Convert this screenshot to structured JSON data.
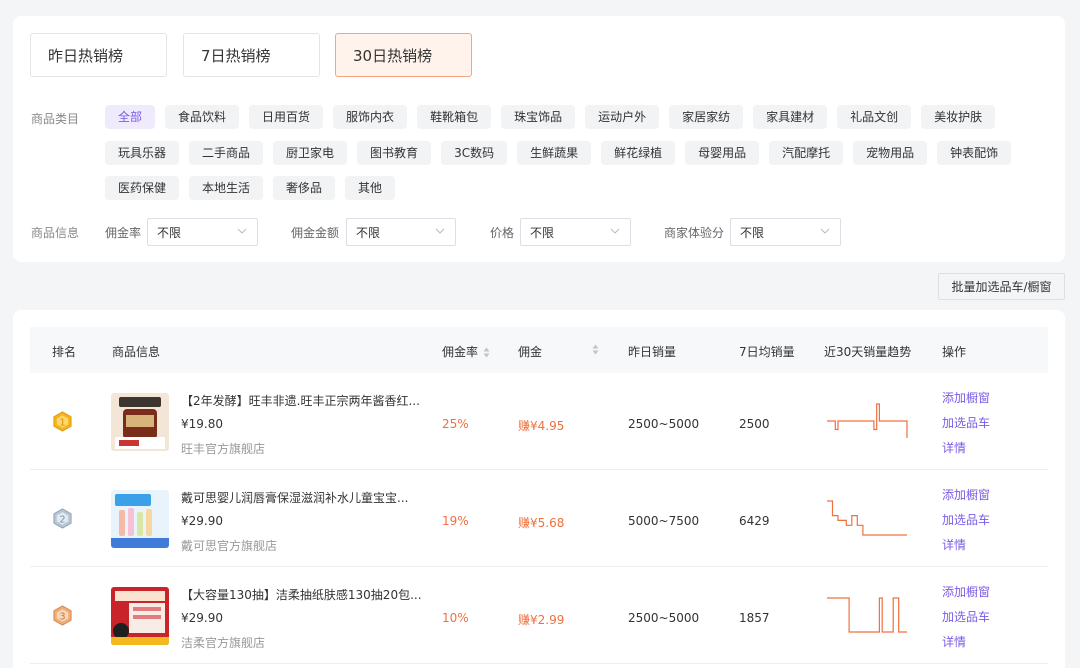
{
  "period_tabs": [
    {
      "label": "昨日热销榜"
    },
    {
      "label": "7日热销榜"
    },
    {
      "label": "30日热销榜",
      "active": true
    }
  ],
  "category": {
    "label": "商品类目",
    "rows": [
      [
        "全部",
        "食品饮料",
        "日用百货",
        "服饰内衣",
        "鞋靴箱包",
        "珠宝饰品",
        "运动户外",
        "家居家纺",
        "家具建材",
        "礼品文创",
        "美妆护肤"
      ],
      [
        "玩具乐器",
        "二手商品",
        "厨卫家电",
        "图书教育",
        "3C数码",
        "生鲜蔬果",
        "鲜花绿植",
        "母婴用品",
        "汽配摩托",
        "宠物用品",
        "钟表配饰"
      ],
      [
        "医药保健",
        "本地生活",
        "奢侈品",
        "其他"
      ]
    ],
    "active": "全部"
  },
  "info_filters": {
    "label": "商品信息",
    "filters": [
      {
        "label": "佣金率",
        "value": "不限"
      },
      {
        "label": "佣金金额",
        "value": "不限"
      },
      {
        "label": "价格",
        "value": "不限"
      },
      {
        "label": "商家体验分",
        "value": "不限"
      }
    ]
  },
  "batch_button": "批量加选品车/橱窗",
  "table": {
    "headers": {
      "rank": "排名",
      "info": "商品信息",
      "rate": "佣金率",
      "commission": "佣金",
      "yesterday": "昨日销量",
      "avg7": "7日均销量",
      "trend": "近30天销量趋势",
      "ops": "操作"
    },
    "rows": [
      {
        "rank": "1",
        "name": "【2年发酵】旺丰非遗.旺丰正宗两年酱香红...",
        "price": "¥19.80",
        "shop": "旺丰官方旗舰店",
        "rate": "25%",
        "commission": "赚¥4.95",
        "yesterday": "2500~5000",
        "avg7": "2500",
        "trend": [
          3,
          3,
          3,
          2,
          3,
          3,
          3,
          3,
          3,
          3,
          3,
          3,
          3,
          3,
          3,
          3,
          3,
          2,
          5,
          3,
          3,
          3,
          3,
          3,
          3,
          3,
          3,
          3,
          3,
          1
        ]
      },
      {
        "rank": "2",
        "name": "戴可思婴儿润唇膏保湿滋润补水儿童宝宝...",
        "price": "¥29.90",
        "shop": "戴可思官方旗舰店",
        "rate": "19%",
        "commission": "赚¥5.68",
        "yesterday": "5000~7500",
        "avg7": "6429",
        "trend": [
          9,
          9,
          6,
          6,
          5,
          5,
          5,
          4,
          4,
          6,
          6,
          4,
          4,
          2,
          2,
          2,
          2,
          2,
          2,
          2,
          2,
          2,
          2,
          2,
          2,
          2,
          2,
          2,
          2,
          2
        ]
      },
      {
        "rank": "3",
        "name": "【大容量130抽】洁柔抽纸肤感130抽20包...",
        "price": "¥29.90",
        "shop": "洁柔官方旗舰店",
        "rate": "10%",
        "commission": "赚¥2.99",
        "yesterday": "2500~5000",
        "avg7": "1857",
        "trend": [
          9,
          9,
          9,
          9,
          9,
          9,
          9,
          9,
          3,
          3,
          3,
          3,
          3,
          3,
          3,
          3,
          3,
          3,
          3,
          9,
          3,
          3,
          3,
          3,
          9,
          9,
          3,
          3,
          3,
          3
        ]
      }
    ],
    "actions": [
      "添加橱窗",
      "加选品车",
      "详情"
    ]
  },
  "colors": {
    "accent": "#7b5ce5",
    "orange": "#f0703e",
    "active_tab_bg": "#fff3eb",
    "gold": "#f5b21e",
    "silver": "#9fb2c4",
    "bronze": "#e79b59"
  }
}
